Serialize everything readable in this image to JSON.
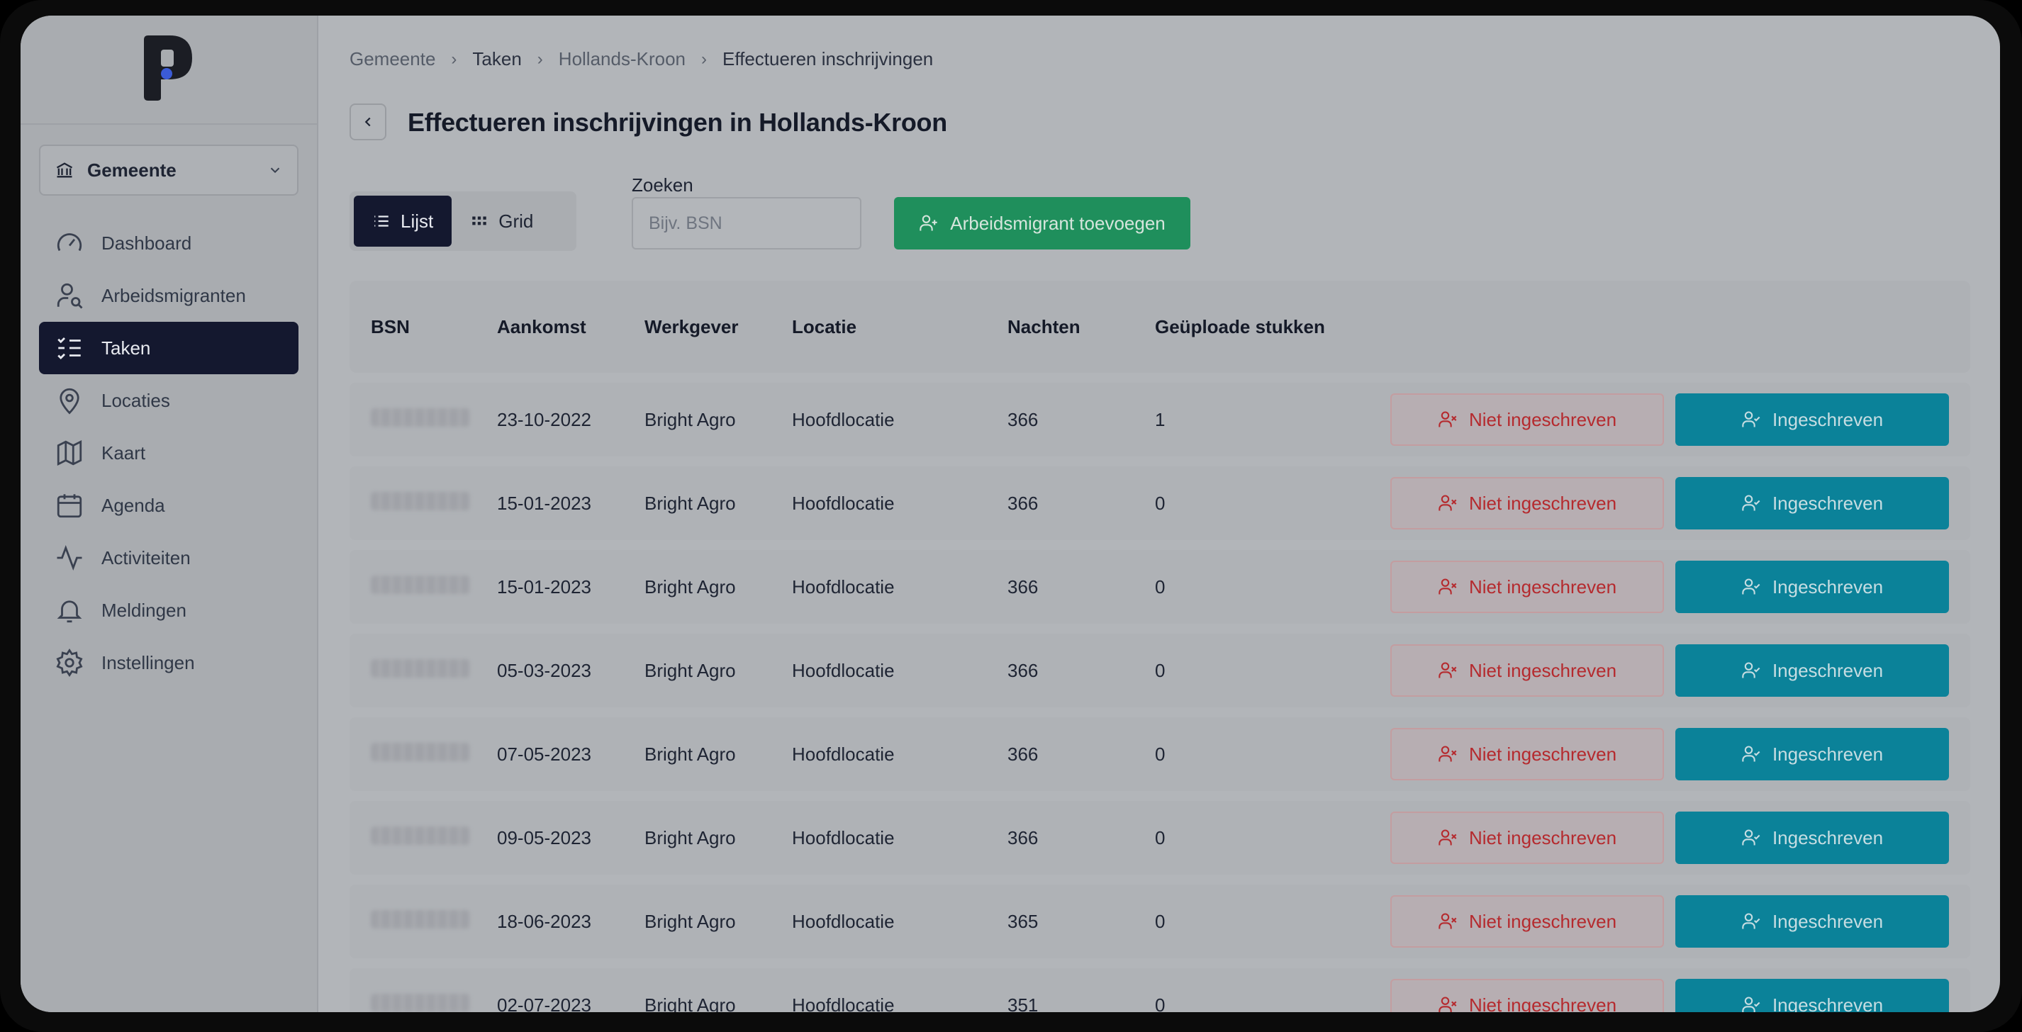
{
  "sidebar": {
    "org_select": {
      "label": "Gemeente",
      "icon": "bank-icon"
    },
    "items": [
      {
        "label": "Dashboard",
        "icon": "gauge-icon",
        "active": false
      },
      {
        "label": "Arbeidsmigranten",
        "icon": "user-search-icon",
        "active": false
      },
      {
        "label": "Taken",
        "icon": "checklist-icon",
        "active": true
      },
      {
        "label": "Locaties",
        "icon": "map-pin-icon",
        "active": false
      },
      {
        "label": "Kaart",
        "icon": "map-icon",
        "active": false
      },
      {
        "label": "Agenda",
        "icon": "calendar-icon",
        "active": false
      },
      {
        "label": "Activiteiten",
        "icon": "activity-icon",
        "active": false
      },
      {
        "label": "Meldingen",
        "icon": "bell-icon",
        "active": false
      },
      {
        "label": "Instellingen",
        "icon": "gear-icon",
        "active": false
      }
    ]
  },
  "breadcrumb": [
    "Gemeente",
    "Taken",
    "Hollands-Kroon",
    "Effectueren inschrijvingen"
  ],
  "page": {
    "title": "Effectueren inschrijvingen in Hollands-Kroon"
  },
  "view_toggle": {
    "list": "Lijst",
    "grid": "Grid",
    "selected": "Lijst"
  },
  "search": {
    "label": "Zoeken",
    "placeholder": "Bijv. BSN",
    "value": ""
  },
  "add_button": {
    "label": "Arbeidsmigrant toevoegen"
  },
  "table": {
    "headers": [
      "BSN",
      "Aankomst",
      "Werkgever",
      "Locatie",
      "Nachten",
      "Geüploade stukken"
    ],
    "actions": {
      "not_registered": "Niet ingeschreven",
      "registered": "Ingeschreven"
    },
    "rows": [
      {
        "bsn": "",
        "arrival": "23-10-2022",
        "employer": "Bright Agro",
        "location": "Hoofdlocatie",
        "nights": "366",
        "uploads": "1"
      },
      {
        "bsn": "",
        "arrival": "15-01-2023",
        "employer": "Bright Agro",
        "location": "Hoofdlocatie",
        "nights": "366",
        "uploads": "0"
      },
      {
        "bsn": "",
        "arrival": "15-01-2023",
        "employer": "Bright Agro",
        "location": "Hoofdlocatie",
        "nights": "366",
        "uploads": "0"
      },
      {
        "bsn": "",
        "arrival": "05-03-2023",
        "employer": "Bright Agro",
        "location": "Hoofdlocatie",
        "nights": "366",
        "uploads": "0"
      },
      {
        "bsn": "",
        "arrival": "07-05-2023",
        "employer": "Bright Agro",
        "location": "Hoofdlocatie",
        "nights": "366",
        "uploads": "0"
      },
      {
        "bsn": "",
        "arrival": "09-05-2023",
        "employer": "Bright Agro",
        "location": "Hoofdlocatie",
        "nights": "366",
        "uploads": "0"
      },
      {
        "bsn": "",
        "arrival": "18-06-2023",
        "employer": "Bright Agro",
        "location": "Hoofdlocatie",
        "nights": "365",
        "uploads": "0"
      },
      {
        "bsn": "",
        "arrival": "02-07-2023",
        "employer": "Bright Agro",
        "location": "Hoofdlocatie",
        "nights": "351",
        "uploads": "0"
      }
    ]
  },
  "colors": {
    "nav_active_bg": "#14182f",
    "add_button_bg": "#1f8f5c",
    "registered_bg": "#0b8299",
    "not_registered_text": "#b52a2e",
    "logo_dot": "#3b5bd6"
  }
}
